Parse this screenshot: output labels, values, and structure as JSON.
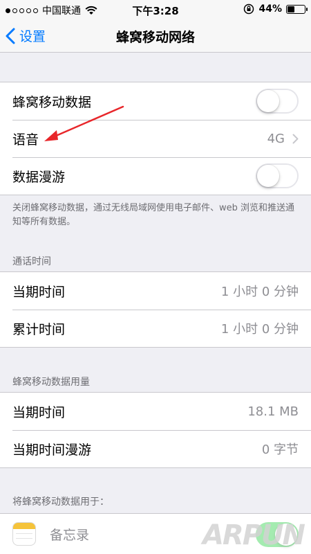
{
  "status_bar": {
    "carrier": "中国联通",
    "time": "下午3:28",
    "battery_percent": "44%",
    "battery_level": 0.44,
    "signal_dots": [
      true,
      false,
      false,
      false,
      false
    ]
  },
  "nav": {
    "back_label": "设置",
    "title": "蜂窝移动网络"
  },
  "main_group": {
    "rows": [
      {
        "label": "蜂窝移动数据",
        "toggle": false
      },
      {
        "label": "语音",
        "value": "4G"
      },
      {
        "label": "数据漫游",
        "toggle": false
      }
    ]
  },
  "main_footer": "关闭蜂窝移动数据，通过无线局域网使用电子邮件、web 浏览和推送通知等所有数据。",
  "call_time": {
    "header": "通话时间",
    "rows": [
      {
        "label": "当期时间",
        "value": "1 小时 0 分钟"
      },
      {
        "label": "累计时间",
        "value": "1 小时 0 分钟"
      }
    ]
  },
  "data_usage": {
    "header": "蜂窝移动数据用量",
    "rows": [
      {
        "label": "当期时间",
        "value": "18.1 MB"
      },
      {
        "label": "当期时间漫游",
        "value": "0 字节"
      }
    ]
  },
  "apps": {
    "header": "将蜂窝移动数据用于：",
    "rows": [
      {
        "label": "备忘录",
        "icon": "notes-app-icon"
      }
    ]
  },
  "annotation_color": "#e8262a",
  "watermark": "ARPUN"
}
